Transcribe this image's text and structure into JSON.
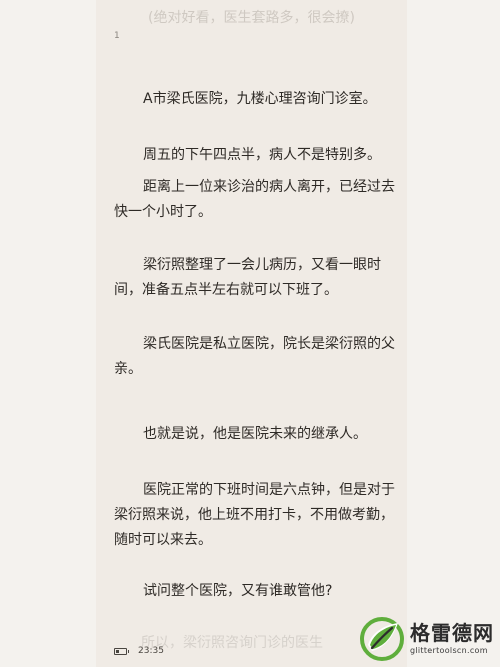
{
  "header": {
    "ghost_text": "(绝对好看，医生套路多，很会撩)",
    "page_number": "1"
  },
  "paragraphs": [
    "A市梁氏医院，九楼心理咨询门诊室。",
    "周五的下午四点半，病人不是特别多。",
    "距离上一位来诊治的病人离开，已经过去快一个小时了。",
    "梁衍照整理了一会儿病历，又看一眼时间，准备五点半左右就可以下班了。",
    "梁氏医院是私立医院，院长是梁衍照的父亲。",
    "也就是说，他是医院未来的继承人。",
    "医院正常的下班时间是六点钟，但是对于梁衍照来说，他上班不用打卡，不用做考勤，随时可以来去。",
    "试问整个医院，又有谁敢管他?"
  ],
  "footer": {
    "ghost_text": "所以，梁衍照咨询门诊的医生",
    "time": "23:35",
    "battery_level": 0.3
  },
  "watermark": {
    "title": "格雷德网",
    "url": "glittertoolscn.com",
    "icon": "leaf-logo-icon",
    "colors": {
      "green": "#5fae3c",
      "dark": "#2c2c2c"
    }
  }
}
